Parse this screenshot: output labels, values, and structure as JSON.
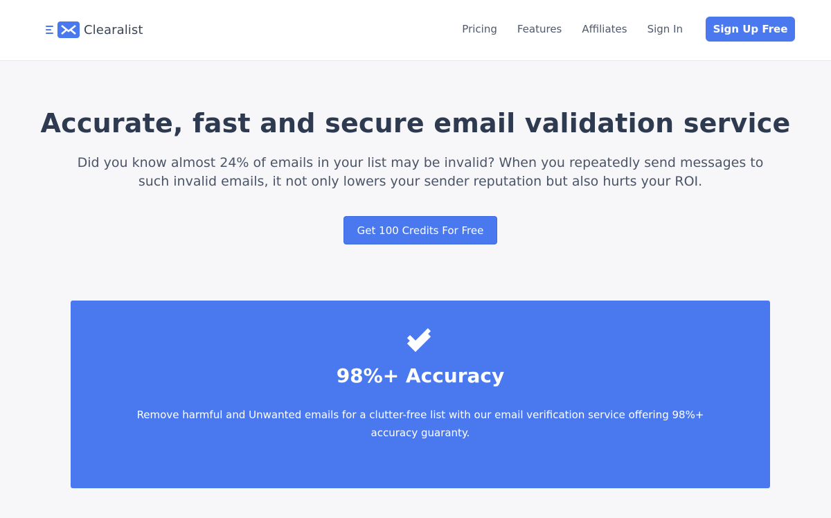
{
  "header": {
    "brand_name": "Clearalist",
    "logo_icon": "envelope-icon",
    "nav": {
      "pricing": "Pricing",
      "features": "Features",
      "affiliates": "Affiliates",
      "sign_in": "Sign In"
    },
    "signup_label": "Sign Up Free"
  },
  "hero": {
    "title": "Accurate, fast and secure email validation service",
    "subtitle": "Did you know almost 24% of emails in your list may be invalid? When you repeatedly send messages to such invalid emails, it not only lowers your sender reputation but also hurts your ROI.",
    "cta_label": "Get 100 Credits For Free"
  },
  "feature": {
    "icon": "double-check-icon",
    "title": "98%+ Accuracy",
    "description": "Remove harmful and Unwanted emails for a clutter-free list with our email verification service offering 98%+ accuracy guaranty."
  },
  "colors": {
    "accent": "#4a78ee",
    "page_background": "#f7f7f9",
    "header_background": "#ffffff",
    "heading_text": "#2e3a4f"
  }
}
